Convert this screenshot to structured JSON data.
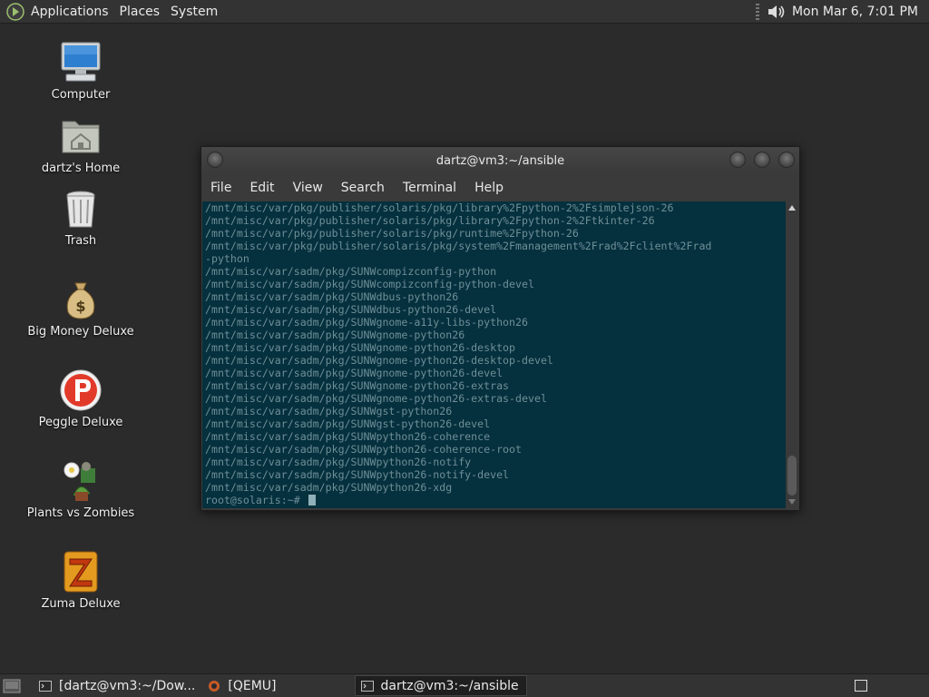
{
  "top_panel": {
    "menus": [
      "Applications",
      "Places",
      "System"
    ],
    "clock": "Mon Mar  6,  7:01 PM",
    "volume_icon": "speaker-icon"
  },
  "desktop_icons": [
    {
      "label": "Computer",
      "icon": "computer-icon"
    },
    {
      "label": "dartz's Home",
      "icon": "home-folder-icon"
    },
    {
      "label": "Trash",
      "icon": "trash-icon"
    },
    {
      "label": "Big Money Deluxe",
      "icon": "money-bag-icon"
    },
    {
      "label": "Peggle Deluxe",
      "icon": "peggle-icon"
    },
    {
      "label": "Plants vs Zombies",
      "icon": "plants-vs-zombies-icon"
    },
    {
      "label": "Zuma Deluxe",
      "icon": "zuma-icon"
    }
  ],
  "terminal": {
    "title": "dartz@vm3:~/ansible",
    "menus": [
      "File",
      "Edit",
      "View",
      "Search",
      "Terminal",
      "Help"
    ],
    "lines": [
      "/mnt/misc/var/pkg/publisher/solaris/pkg/library%2Fpython-2%2Fsimplejson-26",
      "/mnt/misc/var/pkg/publisher/solaris/pkg/library%2Fpython-2%2Ftkinter-26",
      "/mnt/misc/var/pkg/publisher/solaris/pkg/runtime%2Fpython-26",
      "/mnt/misc/var/pkg/publisher/solaris/pkg/system%2Fmanagement%2Frad%2Fclient%2Frad",
      "-python",
      "/mnt/misc/var/sadm/pkg/SUNWcompizconfig-python",
      "/mnt/misc/var/sadm/pkg/SUNWcompizconfig-python-devel",
      "/mnt/misc/var/sadm/pkg/SUNWdbus-python26",
      "/mnt/misc/var/sadm/pkg/SUNWdbus-python26-devel",
      "/mnt/misc/var/sadm/pkg/SUNWgnome-a11y-libs-python26",
      "/mnt/misc/var/sadm/pkg/SUNWgnome-python26",
      "/mnt/misc/var/sadm/pkg/SUNWgnome-python26-desktop",
      "/mnt/misc/var/sadm/pkg/SUNWgnome-python26-desktop-devel",
      "/mnt/misc/var/sadm/pkg/SUNWgnome-python26-devel",
      "/mnt/misc/var/sadm/pkg/SUNWgnome-python26-extras",
      "/mnt/misc/var/sadm/pkg/SUNWgnome-python26-extras-devel",
      "/mnt/misc/var/sadm/pkg/SUNWgst-python26",
      "/mnt/misc/var/sadm/pkg/SUNWgst-python26-devel",
      "/mnt/misc/var/sadm/pkg/SUNWpython26-coherence",
      "/mnt/misc/var/sadm/pkg/SUNWpython26-coherence-root",
      "/mnt/misc/var/sadm/pkg/SUNWpython26-notify",
      "/mnt/misc/var/sadm/pkg/SUNWpython26-notify-devel",
      "/mnt/misc/var/sadm/pkg/SUNWpython26-xdg"
    ],
    "prompt": "root@solaris:~# ",
    "colors": {
      "background": "#05303d",
      "text": "#6e8f98"
    }
  },
  "bottom_panel": {
    "tasks": [
      {
        "label": "[dartz@vm3:~/Dow...",
        "icon": "terminal-icon",
        "active": false
      },
      {
        "label": "[QEMU]",
        "icon": "qemu-icon",
        "active": false
      },
      {
        "label": "dartz@vm3:~/ansible",
        "icon": "terminal-icon",
        "active": true
      }
    ]
  }
}
